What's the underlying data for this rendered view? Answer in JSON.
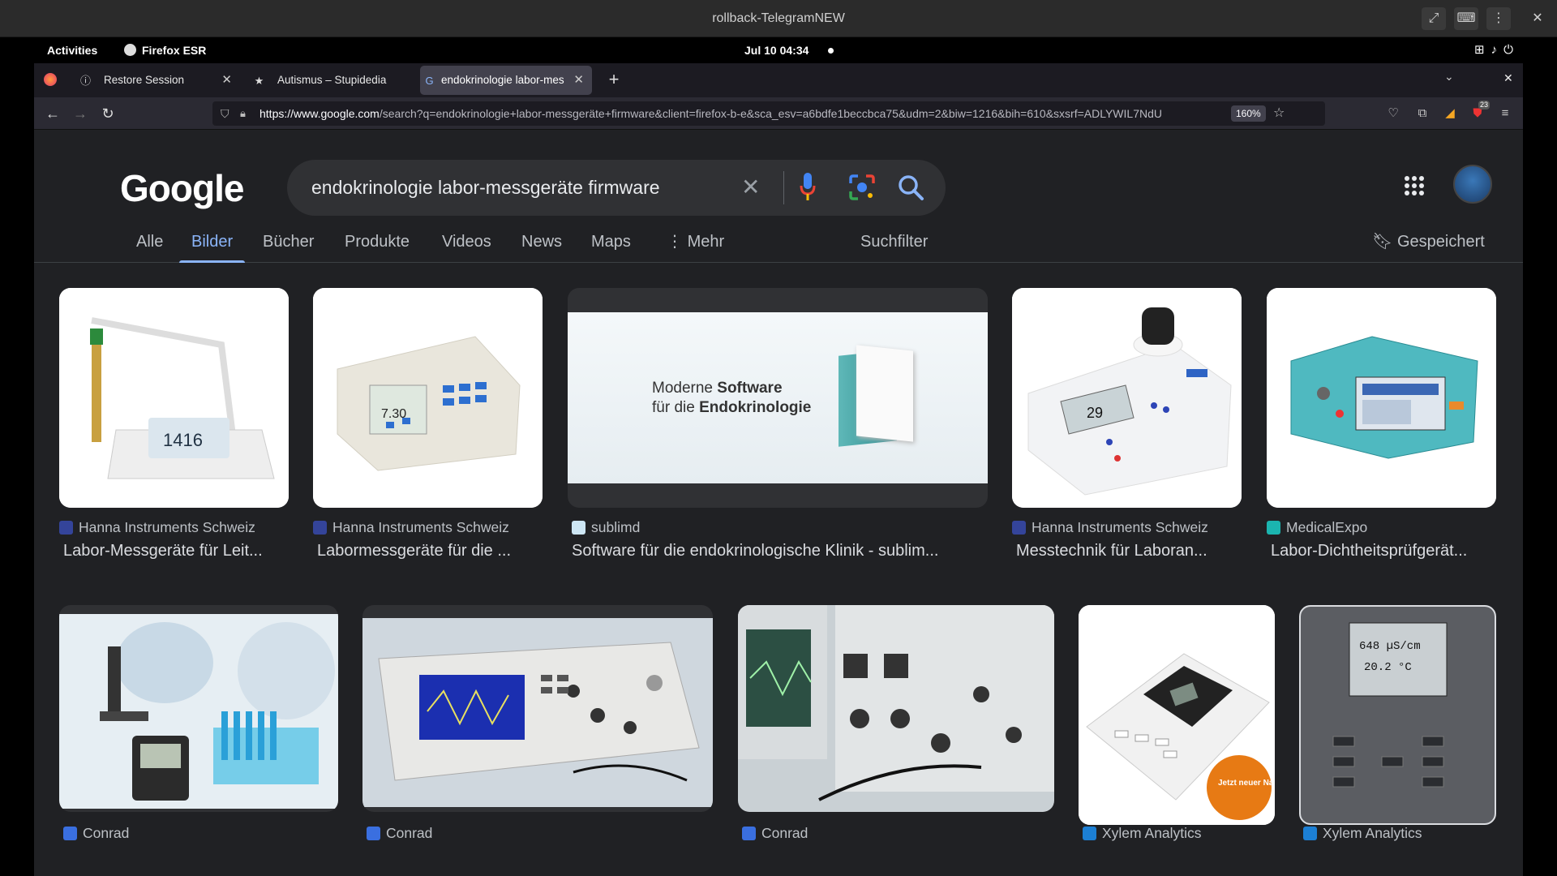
{
  "vm": {
    "title": "rollback-TelegramNEW"
  },
  "gnome": {
    "activities": "Activities",
    "app": "Firefox ESR",
    "clock": "Jul 10  04:34"
  },
  "tabs": [
    {
      "label": "Restore Session",
      "icon": "info-icon"
    },
    {
      "label": "Autismus – Stupidedia",
      "icon": "star-icon"
    },
    {
      "label": "endokrinologie labor-mes",
      "icon": "google-icon"
    }
  ],
  "url": {
    "host": "https://www.google.com",
    "path": "/search?q=endokrinologie+labor-messgeräte+firmware&client=firefox-b-e&sca_esv=a6bdfe1beccbca75&udm=2&biw=1216&bih=610&sxsrf=ADLYWIL7NdU",
    "zoom": "160%"
  },
  "notif_count": "23",
  "google": {
    "logo": "Google",
    "query": "endokrinologie labor-messgeräte firmware"
  },
  "search_tabs": [
    "Alle",
    "Bilder",
    "Bücher",
    "Produkte",
    "Videos",
    "News",
    "Maps",
    "Mehr"
  ],
  "suchfilter": "Suchfilter",
  "gespeichert": "Gespeichert",
  "row1": [
    {
      "source": "Hanna Instruments Schweiz",
      "title": "Labor-Messgeräte für Leit...",
      "reading": "1416"
    },
    {
      "source": "Hanna Instruments Schweiz",
      "title": "Labormessgeräte für die ...",
      "reading": "7.30"
    },
    {
      "source": "sublimd",
      "title": "Software für die endokrinologische Klinik - sublim...",
      "banner1": "Moderne",
      "banner2": "Software",
      "banner3": "für die",
      "banner4": "Endokrinologie"
    },
    {
      "source": "Hanna Instruments Schweiz",
      "title": "Messtechnik für Laboran...",
      "reading": "29"
    },
    {
      "source": "MedicalExpo",
      "title": "Labor-Dichtheitsprüfgerät..."
    }
  ],
  "row2": [
    {
      "source": "Conrad"
    },
    {
      "source": "Conrad"
    },
    {
      "source": "Conrad"
    },
    {
      "source": "Xylem Analytics",
      "badge": "Jetzt neuer Name!"
    },
    {
      "source": "Xylem Analytics",
      "reading1": "648 µS/cm",
      "reading2": "20.2 °C"
    }
  ],
  "colors": {
    "accent": "#8ab4f8",
    "bg": "#202124"
  }
}
